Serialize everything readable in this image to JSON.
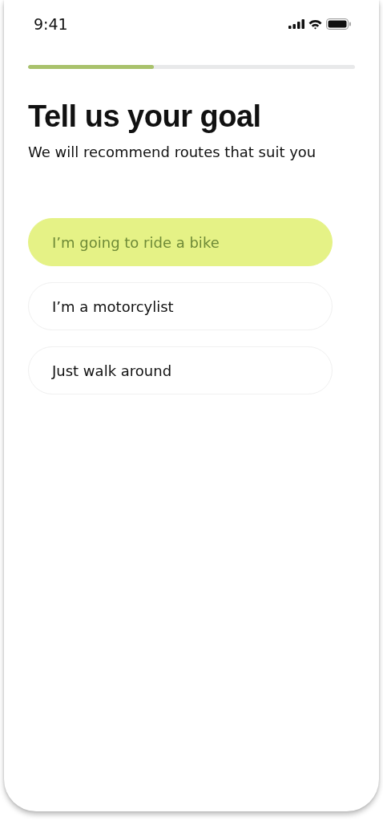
{
  "status_bar": {
    "time": "9:41"
  },
  "progress": {
    "level": 0.385
  },
  "title": "Tell us your goal",
  "subtitle": "We will recommend routes that suit you",
  "options": [
    {
      "label": "I’m going to ride a bike",
      "selected": true
    },
    {
      "label": "I’m a motorcylist",
      "selected": false
    },
    {
      "label": "Just walk around",
      "selected": false
    }
  ]
}
